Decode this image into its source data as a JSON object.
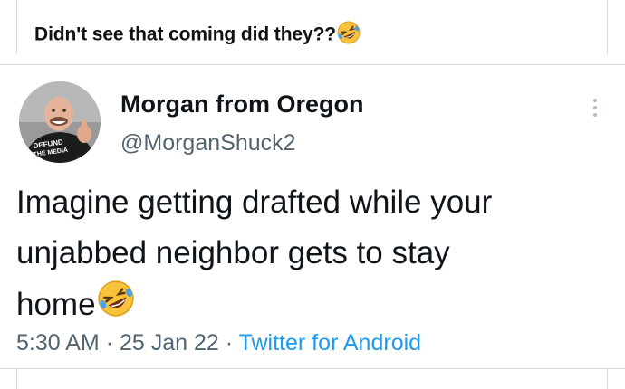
{
  "post": {
    "caption": "Didn't see that coming did they??",
    "caption_emoji": "rolling-on-the-floor-laughing-emoji"
  },
  "tweet": {
    "display_name": "Morgan from Oregon",
    "handle": "@MorganShuck2",
    "avatar": {
      "shirt_text_line1": "DEFUND",
      "shirt_text_line2": "THE MEDIA"
    },
    "text_line1": "Imagine getting drafted while your",
    "text_line2": "unjabbed neighbor gets to stay",
    "text_line3": "home",
    "text_emoji": "rolling-on-the-floor-laughing-emoji",
    "time": "5:30 AM",
    "separator": "·",
    "date": "25 Jan 22",
    "source": "Twitter for Android",
    "more_icon": "vertical-dots-icon"
  },
  "colors": {
    "text": "#0f1419",
    "secondary": "#536471",
    "link": "#1d9bf0",
    "border": "#d9d9d9"
  }
}
